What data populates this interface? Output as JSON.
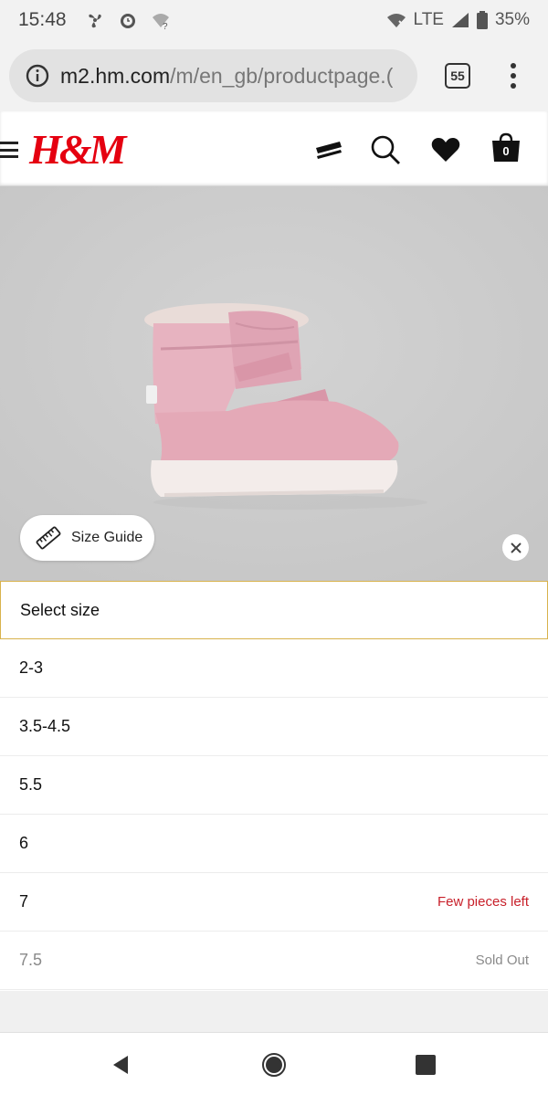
{
  "status_bar": {
    "time": "15:48",
    "network": "LTE",
    "battery": "35%"
  },
  "browser": {
    "url_host": "m2.hm.com",
    "url_path": "/m/en_gb/productpage.(",
    "tab_count": "55"
  },
  "header": {
    "logo_text": "H&M",
    "bag_count": "0",
    "icons": [
      "menu-icon",
      "card-icon",
      "search-icon",
      "heart-icon",
      "bag-icon"
    ]
  },
  "product_image": {
    "size_guide_label": "Size Guide"
  },
  "size_selector": {
    "header": "Select size",
    "sizes": [
      {
        "label": "2-3",
        "note": ""
      },
      {
        "label": "3.5-4.5",
        "note": ""
      },
      {
        "label": "5.5",
        "note": ""
      },
      {
        "label": "6",
        "note": ""
      },
      {
        "label": "7",
        "note": "Few pieces left"
      },
      {
        "label": "7.5",
        "note": "Sold Out"
      }
    ]
  },
  "colors": {
    "brand_red": "#e50010",
    "low_stock_red": "#c8202a",
    "select_border": "#d8b24c",
    "boot_pink": "#e8b6c3"
  }
}
